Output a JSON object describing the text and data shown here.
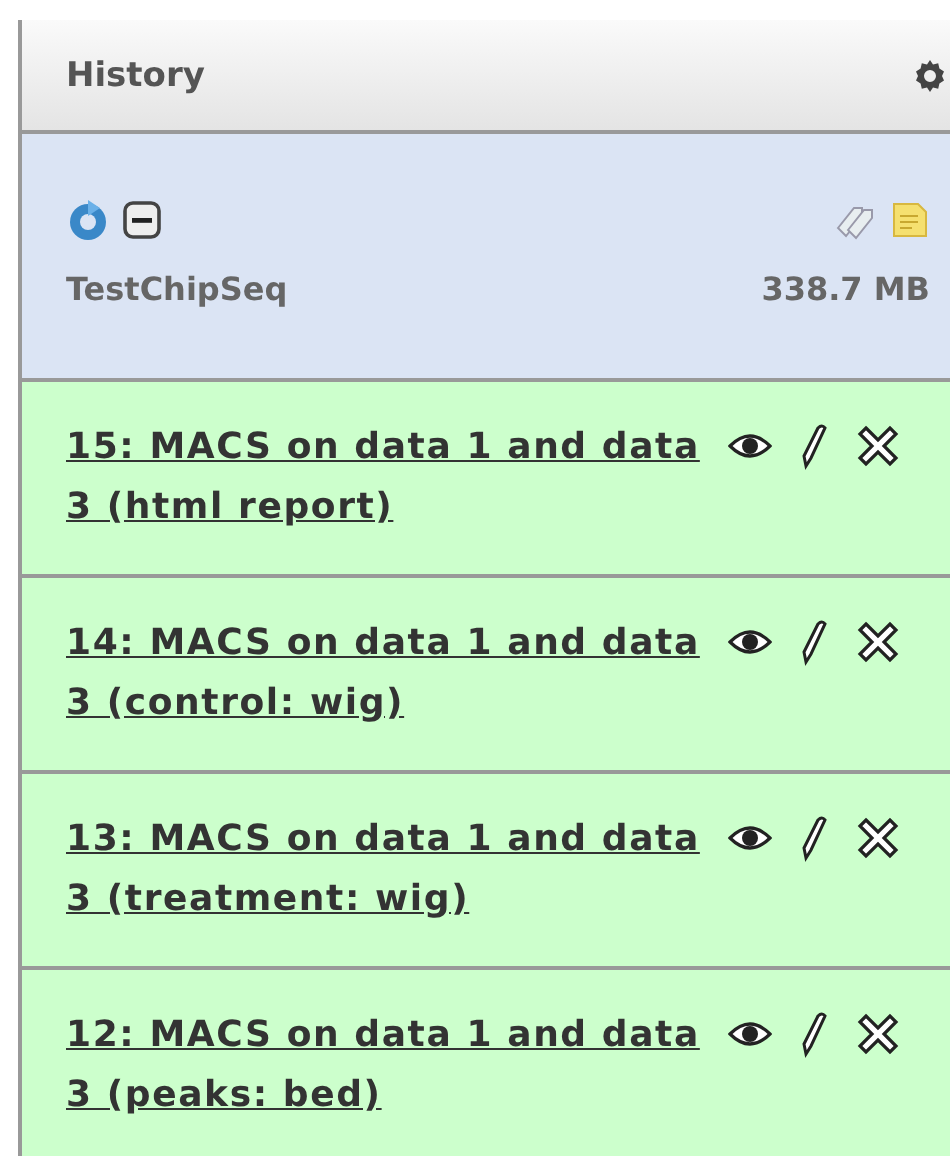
{
  "panel": {
    "title": "History"
  },
  "history": {
    "name": "TestChipSeq",
    "size": "338.7 MB"
  },
  "datasets": [
    {
      "title": "15: MACS on data 1 and data 3 (html report)",
      "color": "#ccffcc"
    },
    {
      "title": "14: MACS on data 1 and data 3 (control: wig)",
      "color": "#ccffcc"
    },
    {
      "title": "13: MACS on data 1 and data 3 (treatment: wig)",
      "color": "#ccffcc"
    },
    {
      "title": "12: MACS on data 1 and data 3 (peaks: bed)",
      "color": "#ccffcc"
    }
  ]
}
